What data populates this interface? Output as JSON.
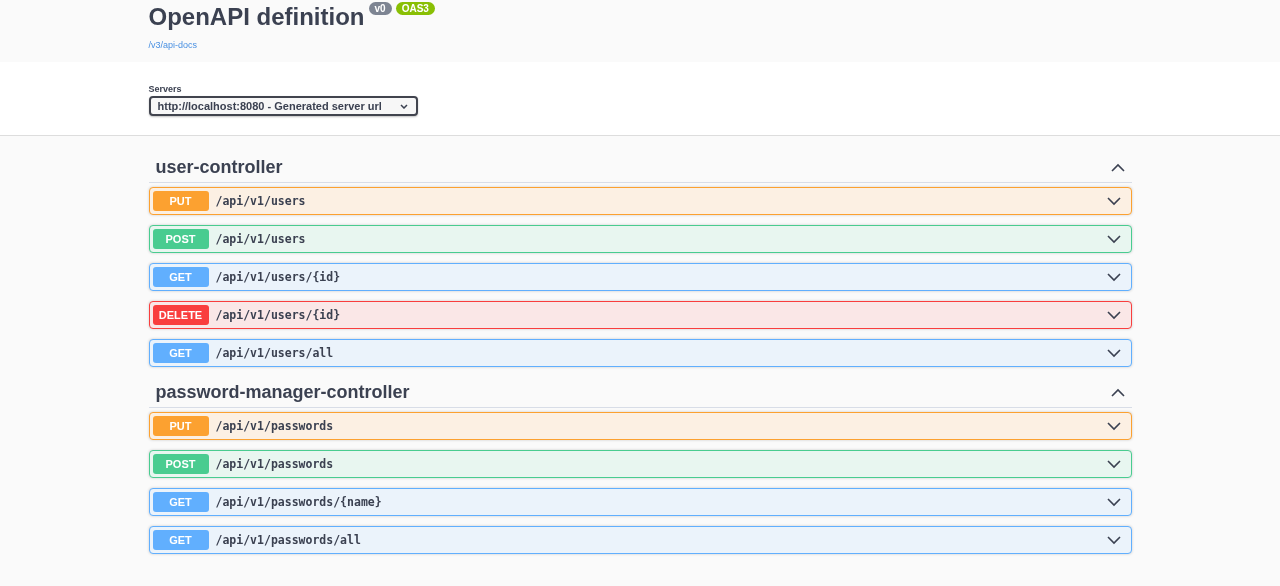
{
  "info": {
    "title": "OpenAPI definition",
    "version": "v0",
    "spec": "OAS3",
    "link": "/v3/api-docs"
  },
  "servers": {
    "label": "Servers",
    "value": "http://localhost:8080 - Generated server url"
  },
  "tags": [
    {
      "name": "user-controller",
      "expanded": true,
      "operations": [
        {
          "method": "PUT",
          "path": "/api/v1/users"
        },
        {
          "method": "POST",
          "path": "/api/v1/users"
        },
        {
          "method": "GET",
          "path": "/api/v1/users/{id}"
        },
        {
          "method": "DELETE",
          "path": "/api/v1/users/{id}"
        },
        {
          "method": "GET",
          "path": "/api/v1/users/all"
        }
      ]
    },
    {
      "name": "password-manager-controller",
      "expanded": true,
      "operations": [
        {
          "method": "PUT",
          "path": "/api/v1/passwords"
        },
        {
          "method": "POST",
          "path": "/api/v1/passwords"
        },
        {
          "method": "GET",
          "path": "/api/v1/passwords/{name}"
        },
        {
          "method": "GET",
          "path": "/api/v1/passwords/all"
        }
      ]
    }
  ]
}
